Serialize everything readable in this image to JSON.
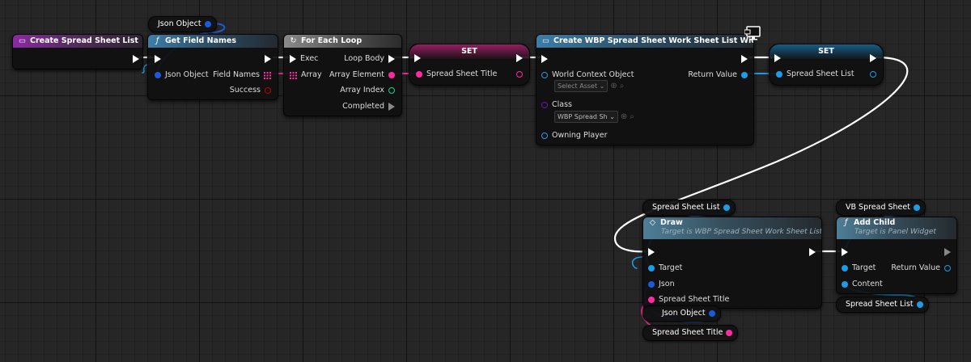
{
  "colors": {
    "exec": "#ffffff",
    "object_pin": "#1f9be5",
    "struct_pin": "#1d5ad9",
    "string_pin": "#ff2ba0",
    "bool_pin": "#9b0000",
    "int_pin": "#1dd08d",
    "class_pin": "#6a1aa8",
    "wire_exec": "#ffffff"
  },
  "nodes": {
    "create_list": {
      "title": "Create Spread Sheet List",
      "icon": "event-icon"
    },
    "get_field_names": {
      "title": "Get Field Names",
      "icon": "function-icon",
      "json_object": "Json Object",
      "field_names": "Field Names",
      "success": "Success"
    },
    "for_each": {
      "title": "For Each Loop",
      "icon": "loop-icon",
      "exec": "Exec",
      "loop_body": "Loop Body",
      "array": "Array",
      "array_element": "Array Element",
      "array_index": "Array Index",
      "completed": "Completed"
    },
    "set_title": {
      "title": "SET",
      "pin": "Spread Sheet Title"
    },
    "create_widget": {
      "title": "Create WBP Spread Sheet Work Sheet List Widget",
      "world_context": "World Context Object",
      "select_asset": "Select Asset",
      "class": "Class",
      "class_value": "WBP Spread Sh",
      "owning_player": "Owning Player",
      "return_value": "Return Value"
    },
    "set_list": {
      "title": "SET",
      "pin": "Spread Sheet List"
    },
    "draw": {
      "title": "Draw",
      "subtitle": "Target is WBP Spread Sheet Work Sheet List",
      "target": "Target",
      "json": "Json",
      "spread_sheet_title": "Spread Sheet Title"
    },
    "add_child": {
      "title": "Add Child",
      "subtitle": "Target is Panel Widget",
      "target": "Target",
      "content": "Content",
      "return_value": "Return Value"
    }
  },
  "variables": {
    "json_object_top": "Json Object",
    "spread_sheet_list_draw": "Spread Sheet List",
    "vb_spread_sheet": "VB Spread Sheet",
    "spread_sheet_list_add": "Spread Sheet List",
    "json_object_bottom": "Json Object",
    "spread_sheet_title_bottom": "Spread Sheet Title"
  }
}
